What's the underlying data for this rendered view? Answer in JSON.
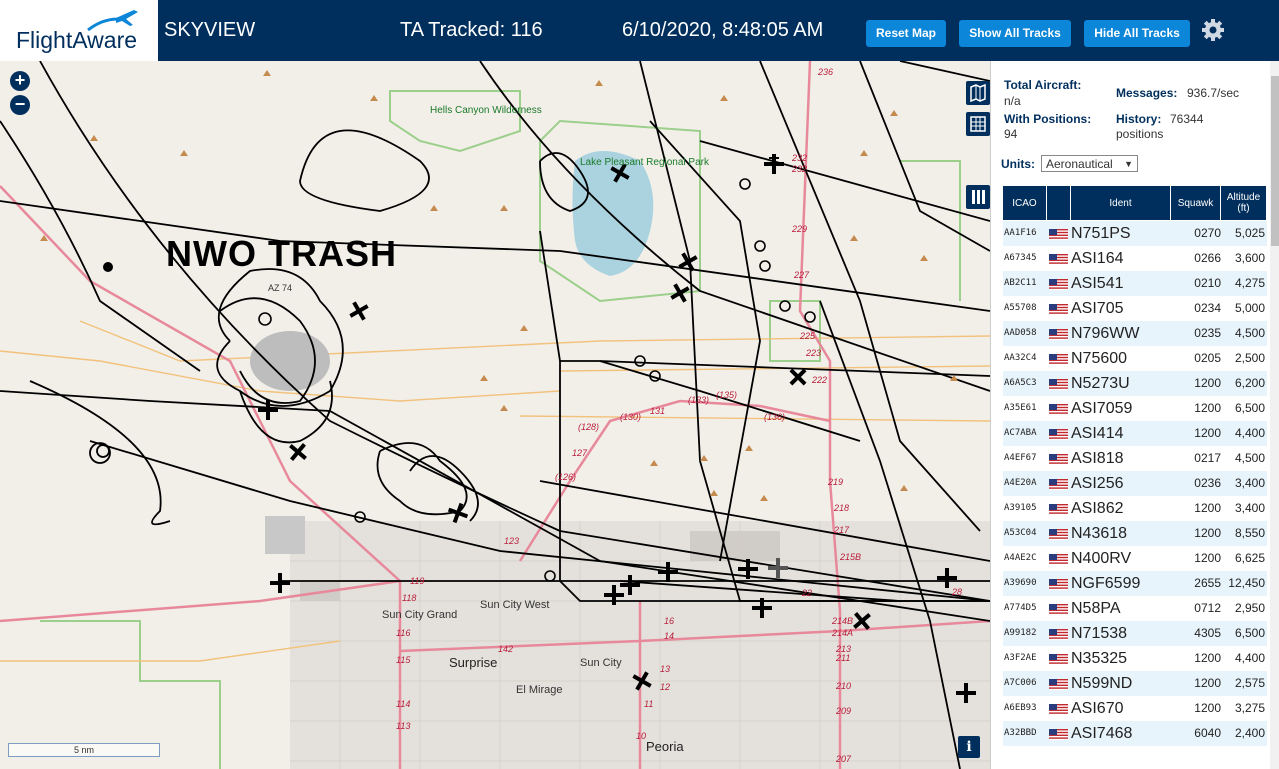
{
  "header": {
    "logo": "FlightAware",
    "app_title": "SKYVIEW",
    "ta_tracked": "TA Tracked: 116",
    "datetime": "6/10/2020, 8:48:05 AM",
    "buttons": {
      "reset": "Reset Map",
      "show_all": "Show All Tracks",
      "hide_all": "Hide All Tracks"
    },
    "settings_icon": "gear-icon"
  },
  "map": {
    "zoom_in": "+",
    "zoom_out": "−",
    "overlay_text": "NWO TRASH",
    "scale": "5 nm",
    "info": "i",
    "places": {
      "hells_canyon": "Hells Canyon Wilderness",
      "lake_pleasant": "Lake Pleasant Regional Park",
      "sun_city_grand": "Sun City Grand",
      "sun_city_west": "Sun City West",
      "surprise": "Surprise",
      "el_mirage": "El Mirage",
      "sun_city": "Sun City",
      "peoria": "Peoria",
      "az74": "AZ 74"
    },
    "route_labels": [
      "236",
      "232",
      "232",
      "229",
      "227",
      "225",
      "223",
      "222",
      "(135)",
      "(133)",
      "(136)",
      "(130)",
      "131",
      "(128)",
      "127",
      "(126)",
      "123",
      "119",
      "118",
      "116",
      "115",
      "114",
      "113",
      "142",
      "16",
      "14",
      "13",
      "12",
      "11",
      "10",
      "219",
      "218",
      "217",
      "215B",
      "214B",
      "214A",
      "213",
      "211",
      "210",
      "209",
      "207",
      "28",
      "22"
    ]
  },
  "panel": {
    "total_aircraft_label": "Total Aircraft:",
    "total_aircraft_value": "n/a",
    "messages_label": "Messages:",
    "messages_value": "936.7/sec",
    "with_positions_label": "With Positions:",
    "with_positions_value": "94",
    "history_label": "History:",
    "history_value": "76344",
    "history_unit": "positions",
    "units_label": "Units:",
    "units_value": "Aeronautical",
    "columns": [
      "ICAO",
      "",
      "Ident",
      "Squawk",
      "Altitude (ft)"
    ],
    "rows": [
      {
        "icao": "AA1F16",
        "ident": "N751PS",
        "squawk": "0270",
        "alt": "5,025"
      },
      {
        "icao": "A67345",
        "ident": "ASI164",
        "squawk": "0266",
        "alt": "3,600"
      },
      {
        "icao": "AB2C11",
        "ident": "ASI541",
        "squawk": "0210",
        "alt": "4,275"
      },
      {
        "icao": "A55708",
        "ident": "ASI705",
        "squawk": "0234",
        "alt": "5,000"
      },
      {
        "icao": "AAD058",
        "ident": "N796WW",
        "squawk": "0235",
        "alt": "4,500"
      },
      {
        "icao": "AA32C4",
        "ident": "N75600",
        "squawk": "0205",
        "alt": "2,500"
      },
      {
        "icao": "A6A5C3",
        "ident": "N5273U",
        "squawk": "1200",
        "alt": "6,200"
      },
      {
        "icao": "A35E61",
        "ident": "ASI7059",
        "squawk": "1200",
        "alt": "6,500"
      },
      {
        "icao": "AC7ABA",
        "ident": "ASI414",
        "squawk": "1200",
        "alt": "4,400"
      },
      {
        "icao": "A4EF67",
        "ident": "ASI818",
        "squawk": "0217",
        "alt": "4,500"
      },
      {
        "icao": "A4E20A",
        "ident": "ASI256",
        "squawk": "0236",
        "alt": "3,400"
      },
      {
        "icao": "A39105",
        "ident": "ASI862",
        "squawk": "1200",
        "alt": "3,400"
      },
      {
        "icao": "A53C04",
        "ident": "N43618",
        "squawk": "1200",
        "alt": "8,550"
      },
      {
        "icao": "A4AE2C",
        "ident": "N400RV",
        "squawk": "1200",
        "alt": "6,625"
      },
      {
        "icao": "A39690",
        "ident": "NGF6599",
        "squawk": "2655",
        "alt": "12,450"
      },
      {
        "icao": "A774D5",
        "ident": "N58PA",
        "squawk": "0712",
        "alt": "2,950"
      },
      {
        "icao": "A99182",
        "ident": "N71538",
        "squawk": "4305",
        "alt": "6,500"
      },
      {
        "icao": "A3F2AE",
        "ident": "N35325",
        "squawk": "1200",
        "alt": "4,400"
      },
      {
        "icao": "A7C006",
        "ident": "N599ND",
        "squawk": "1200",
        "alt": "2,575"
      },
      {
        "icao": "A6EB93",
        "ident": "ASI670",
        "squawk": "1200",
        "alt": "3,275"
      },
      {
        "icao": "A32BBD",
        "ident": "ASI7468",
        "squawk": "6040",
        "alt": "2,400"
      }
    ]
  },
  "colors": {
    "header_bg": "#002f5d",
    "button_bg": "#0c86d8",
    "row_alt": "#e8f4fb",
    "map_bg": "#f2efe9",
    "track": "#000000",
    "road": "#e8899b"
  }
}
